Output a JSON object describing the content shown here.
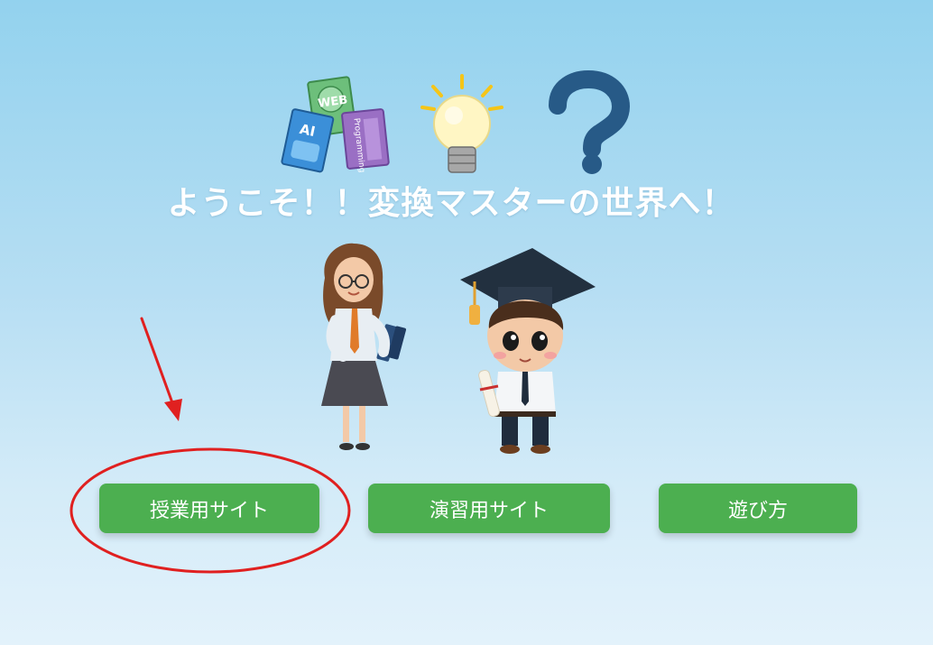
{
  "page": {
    "title": "ようこそ！！変換マスターの世界へ！"
  },
  "hero": {
    "books": {
      "web_label": "WEB",
      "ai_label": "AI",
      "programming_label": "Programming"
    }
  },
  "buttons": {
    "lesson_label": "授業用サイト",
    "practice_label": "演習用サイト",
    "howto_label": "遊び方"
  },
  "colors": {
    "button_green": "#4caf50",
    "annotation_red": "#e02020",
    "title_white": "#ffffff"
  },
  "icons": [
    "books-icon",
    "lightbulb-icon",
    "question-mark-icon",
    "teacher-illustration",
    "graduate-illustration",
    "arrow-annotation",
    "circle-annotation"
  ]
}
